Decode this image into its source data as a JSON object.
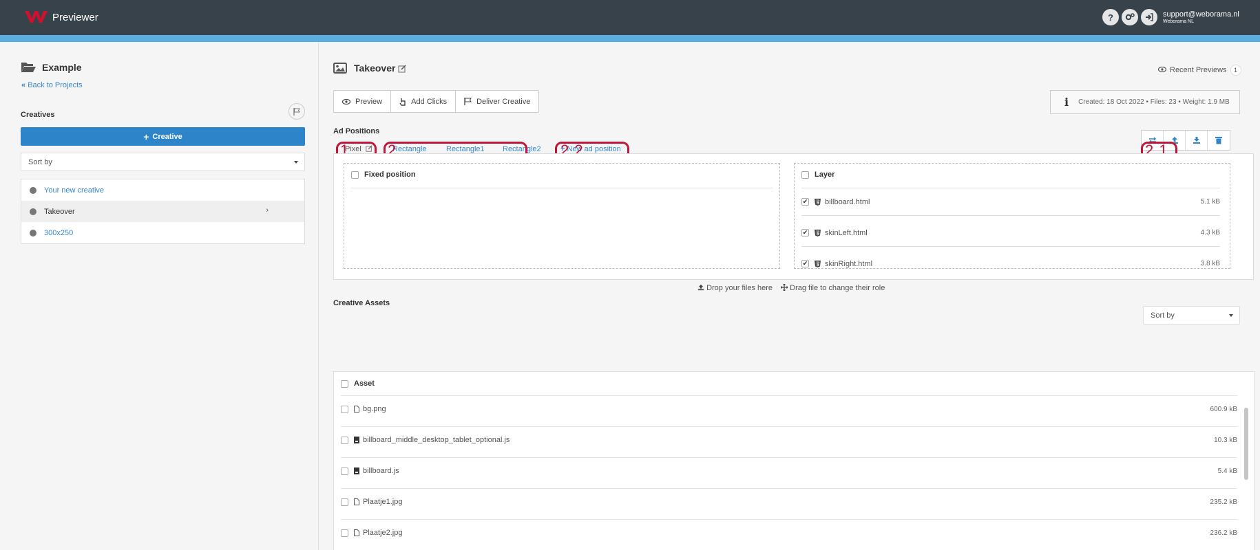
{
  "header": {
    "app_name": "Previewer",
    "help_icon": "help-icon",
    "settings_icon": "cogs-icon",
    "logout_icon": "sign-out-icon",
    "user_email": "support@weborama.nl",
    "user_org": "Weborama NL"
  },
  "sidebar": {
    "project_title": "Example",
    "back_link": "Back to Projects",
    "creatives_label": "Creatives",
    "add_creative_label": "Creative",
    "sort_placeholder": "Sort by",
    "creatives": [
      {
        "name": "Your new creative"
      },
      {
        "name": "Takeover"
      },
      {
        "name": "300x250"
      }
    ]
  },
  "main": {
    "title": "Takeover",
    "recent_previews_label": "Recent Previews",
    "recent_previews_count": "1",
    "actions": {
      "preview": "Preview",
      "add_clicks": "Add Clicks",
      "deliver": "Deliver Creative"
    },
    "info_text": "Created: 18 Oct 2022 • Files: 23 • Weight: 1.9 MB",
    "ad_positions_label": "Ad Positions",
    "tabs": {
      "pixel": "Pixel",
      "rectangle": "Rectangle",
      "rectangle1": "Rectangle1",
      "rectangle2": "Rectangle2",
      "new_position": "New ad position"
    },
    "annotations": {
      "a1": "1",
      "a2": "2",
      "a3": "2.2",
      "a4": "2.1"
    },
    "fixed_panel_label": "Fixed position",
    "layer_panel_label": "Layer",
    "layers": [
      {
        "name": "billboard.html",
        "size": "5.1 kB"
      },
      {
        "name": "skinLeft.html",
        "size": "4.3 kB"
      },
      {
        "name": "skinRight.html",
        "size": "3.8 kB"
      }
    ],
    "drop_hint": "Drop your files here",
    "drag_hint": "Drag file to change their role",
    "creative_assets_label": "Creative Assets",
    "assets_sort_placeholder": "Sort by",
    "asset_header": "Asset",
    "assets": [
      {
        "name": "bg.png",
        "size": "600.9 kB"
      },
      {
        "name": "billboard_middle_desktop_tablet_optional.js",
        "size": "10.3 kB"
      },
      {
        "name": "billboard.js",
        "size": "5.4 kB"
      },
      {
        "name": "Plaatje1.jpg",
        "size": "235.2 kB"
      },
      {
        "name": "Plaatje2.jpg",
        "size": "236.2 kB"
      }
    ]
  },
  "colors": {
    "header_bg": "#37424a",
    "stripe": "#5aaee0",
    "accent": "#2e84c9",
    "brand_red": "#d0102c",
    "annotation": "#c0163c"
  }
}
